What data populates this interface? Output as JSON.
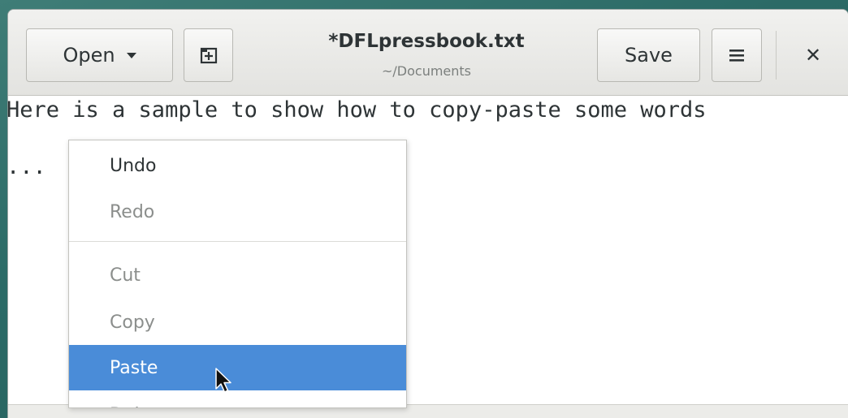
{
  "header": {
    "open_label": "Open",
    "save_label": "Save",
    "title": "*DFLpressbook.txt",
    "subtitle": "~/Documents"
  },
  "editor": {
    "lines": [
      "Here is a sample to show how to copy-paste some words",
      "..."
    ]
  },
  "context_menu": {
    "items": [
      {
        "label": "Undo",
        "enabled": true
      },
      {
        "label": "Redo",
        "enabled": false
      },
      {
        "label": "Cut",
        "enabled": false
      },
      {
        "label": "Copy",
        "enabled": false
      },
      {
        "label": "Paste",
        "enabled": true,
        "highlighted": true
      },
      {
        "label": "Delete",
        "enabled": false
      }
    ]
  },
  "icons": {
    "open_dropdown": "chevron-down-icon",
    "new_tab": "new-document-icon",
    "menu": "hamburger-menu-icon",
    "close": "close-icon",
    "pointer": "mouse-pointer-icon"
  },
  "colors": {
    "highlight": "#4a8cd8",
    "text": "#2e3436",
    "disabled_text": "#8b8e8c",
    "desktop": "#2b6a66"
  }
}
